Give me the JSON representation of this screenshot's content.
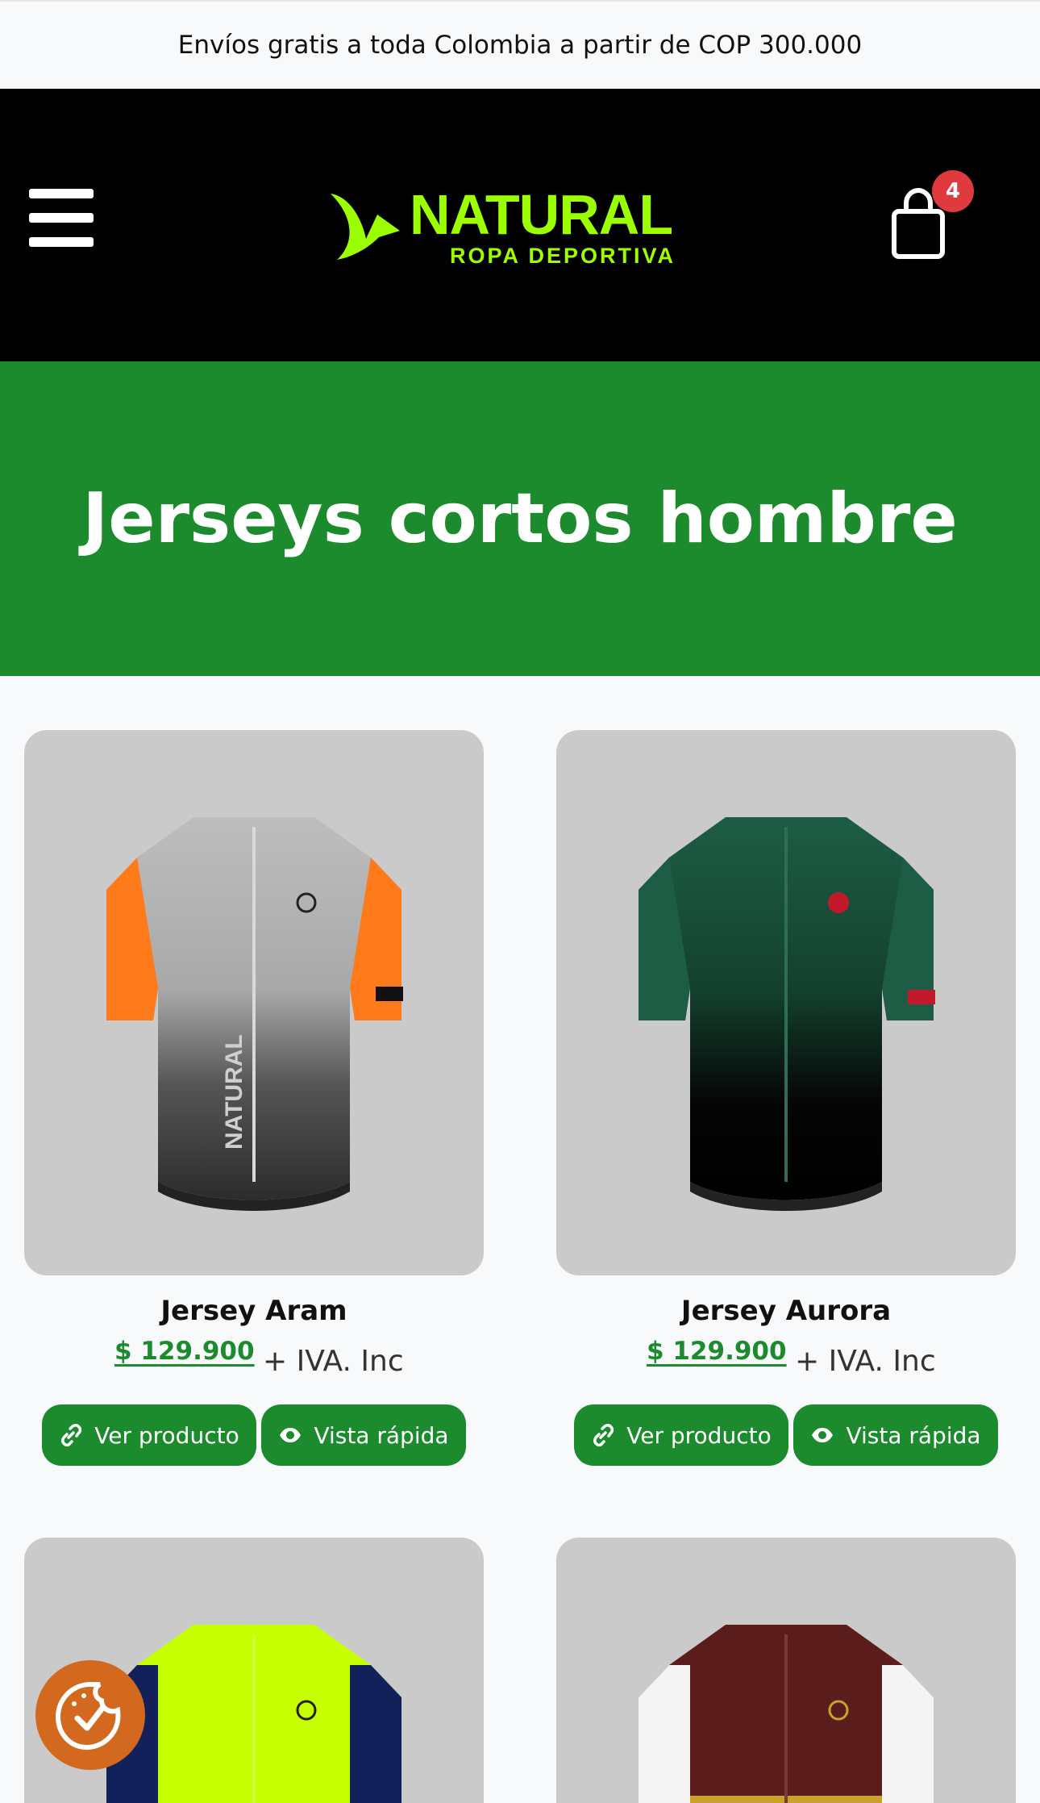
{
  "announcement": "Envíos gratis a toda Colombia a partir de COP 300.000",
  "header": {
    "logo_text": "NATURAL",
    "logo_subtext": "ROPA DEPORTIVA",
    "cart_count": "4",
    "brand_color": "#9cff00"
  },
  "hero": {
    "title": "Jerseys cortos hombre",
    "background": "#1c8b2e"
  },
  "products": [
    {
      "name": "Jersey Aram",
      "price": "$ 129.900",
      "tax": "+ IVA. Inc",
      "view_label": "Ver producto",
      "quick_label": "Vista rápida",
      "colors": [
        "#b9b9b9",
        "#ff7a1a",
        "#2b2b2b"
      ]
    },
    {
      "name": "Jersey Aurora",
      "price": "$ 129.900",
      "tax": "+ IVA. Inc",
      "view_label": "Ver producto",
      "quick_label": "Vista rápida",
      "colors": [
        "#1d5d45",
        "#0a0a0a",
        "#c3182b"
      ]
    },
    {
      "colors": [
        "#c6ff00",
        "#13215a"
      ]
    },
    {
      "colors": [
        "#5b1c1c",
        "#ffffff",
        "#c9a227"
      ]
    }
  ],
  "icons": {
    "menu": "hamburger-icon",
    "cart": "shopping-bag-icon",
    "link": "link-icon",
    "eye": "eye-icon",
    "cookie": "cookie-consent-icon"
  }
}
